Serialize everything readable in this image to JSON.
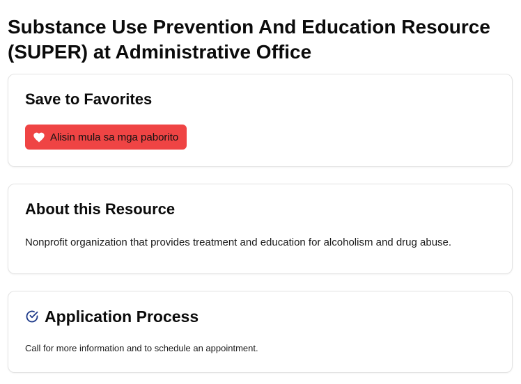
{
  "page": {
    "title": "Substance Use Prevention And Education Resource (SUPER) at Administrative Office"
  },
  "favorites": {
    "heading": "Save to Favorites",
    "button_label": "Alisin mula sa mga paborito",
    "button_icon": "heart-icon",
    "button_color": "#ef4444"
  },
  "about": {
    "heading": "About this Resource",
    "description": "Nonprofit organization that provides treatment and education for alcoholism and drug abuse."
  },
  "application": {
    "heading": "Application Process",
    "icon": "check-circle-icon",
    "icon_color": "#1e3a8a",
    "description": "Call for more information and to schedule an appointment."
  }
}
